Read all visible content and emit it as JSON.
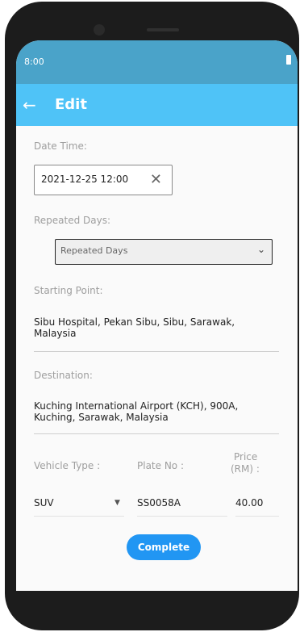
{
  "status": {
    "time": "8:00"
  },
  "appbar": {
    "title": "Edit",
    "back_icon": "arrow-left-icon"
  },
  "form": {
    "date_time": {
      "label": "Date Time:",
      "value": "2021-12-25 12:00",
      "clear_icon": "close-icon"
    },
    "repeated_days": {
      "label": "Repeated Days:",
      "placeholder": "Repeated Days",
      "icon": "chevron-down-icon"
    },
    "starting_point": {
      "label": "Starting Point:",
      "value": "Sibu Hospital, Pekan Sibu, Sibu, Sarawak, Malaysia"
    },
    "destination": {
      "label": "Destination:",
      "value": "Kuching International Airport (KCH), 900A, Kuching, Sarawak, Malaysia"
    },
    "vehicle": {
      "type_label": "Vehicle Type :",
      "plate_label": "Plate No :",
      "price_label_line1": "Price",
      "price_label_line2": "(RM) :",
      "type_value": "SUV",
      "plate_value": "SS0058A",
      "price_value": "40.00"
    },
    "complete_label": "Complete"
  },
  "colors": {
    "statusbar": "#4aa3c9",
    "appbar": "#4fc3f7",
    "button": "#2196f3"
  }
}
